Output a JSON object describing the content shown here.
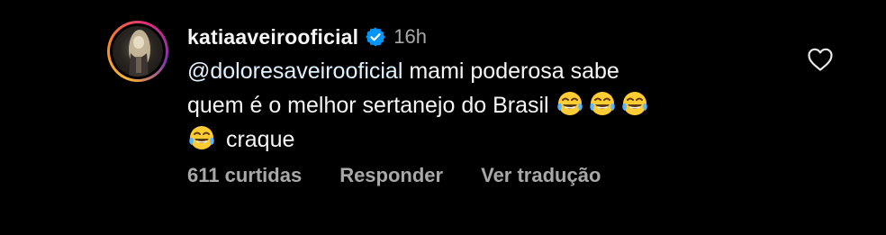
{
  "comment": {
    "username": "katiaaveirooficial",
    "time_ago": "16h",
    "mention": "@doloresaveirooficial",
    "line1_rest": " mami poderosa sabe",
    "line2": "quem é o melhor sertanejo do Brasil ",
    "line3": "craque",
    "likes": "611 curtidas",
    "reply_label": "Responder",
    "translate_label": "Ver tradução"
  },
  "colors": {
    "background": "#000000",
    "text": "#f5f5f5",
    "secondary": "#a8a8a8",
    "verified_blue": "#0095f6"
  },
  "icons": {
    "avatar": "profile-photo",
    "verified": "verified-badge-icon",
    "emoji": "face-with-tears-of-joy",
    "like": "heart-outline-icon"
  }
}
